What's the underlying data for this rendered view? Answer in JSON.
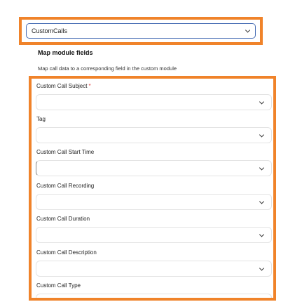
{
  "module_select": {
    "value": "CustomCalls"
  },
  "section": {
    "title": "Map module fields",
    "description": "Map call data to a corresponding field in the custom module"
  },
  "fields": [
    {
      "label": "Custom Call Subject",
      "required": "*"
    },
    {
      "label": "Tag"
    },
    {
      "label": "Custom Call Start Time"
    },
    {
      "label": "Custom Call Recording"
    },
    {
      "label": "Custom Call Duration"
    },
    {
      "label": "Custom Call Description"
    },
    {
      "label": "Custom Call Type"
    }
  ],
  "colors": {
    "highlight": "#f0832a",
    "select_border": "#4a6fb5",
    "required": "#e04848"
  },
  "icons": {
    "dropdown": "chevron-down-icon"
  }
}
